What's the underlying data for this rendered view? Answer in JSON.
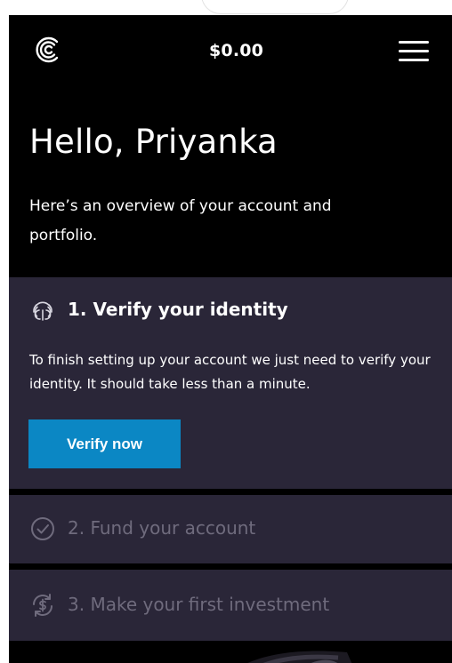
{
  "header": {
    "logo_icon": "brand-logo-icon",
    "balance": "$0.00",
    "menu_icon": "hamburger-menu-icon"
  },
  "hero": {
    "greeting": "Hello, Priyanka",
    "subtitle": "Here’s an overview of your account and portfolio."
  },
  "steps": [
    {
      "title": "1. Verify your identity",
      "icon": "fingerprint-icon",
      "description": "To finish setting up your account we just need to verify your identity. It should take less than a minute.",
      "button_label": "Verify now"
    },
    {
      "title": "2. Fund your account",
      "icon": "check-circle-icon"
    },
    {
      "title": "3. Make your first investment",
      "icon": "dollar-cycle-icon"
    }
  ],
  "colors": {
    "background": "#000000",
    "card": "#2a2638",
    "accent": "#0b87c4",
    "muted_text": "#6f6b7d"
  }
}
